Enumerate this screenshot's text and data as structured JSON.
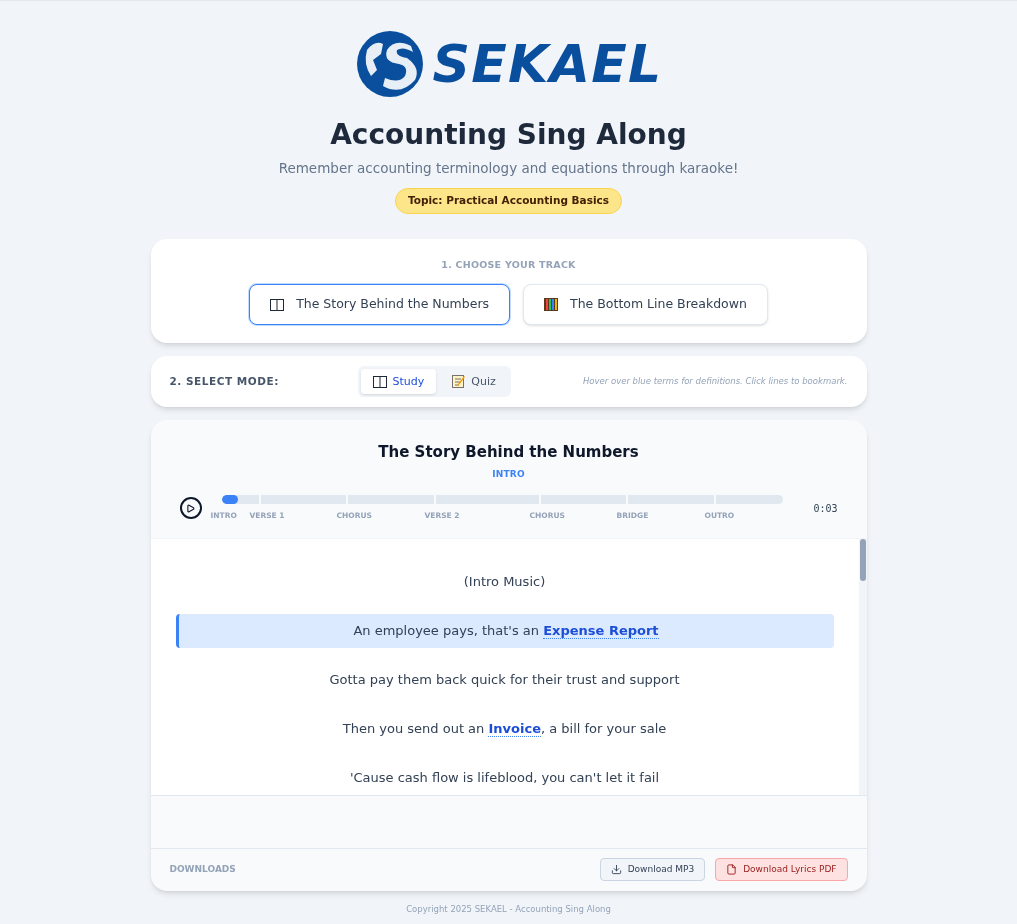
{
  "logo": {
    "text": "SEKAEL"
  },
  "title": "Accounting Sing Along",
  "subtitle": "Remember accounting terminology and equations through karaoke!",
  "topic": "Topic: Practical Accounting Basics",
  "track_section": {
    "heading": "1. CHOOSE YOUR TRACK",
    "tracks": [
      {
        "label": "The Story Behind the Numbers",
        "kind": "book",
        "selected": true
      },
      {
        "label": "The Bottom Line Breakdown",
        "kind": "abacus",
        "selected": false
      }
    ]
  },
  "mode_section": {
    "heading": "2. SELECT MODE:",
    "modes": [
      {
        "label": "Study",
        "kind": "book",
        "selected": true
      },
      {
        "label": "Quiz",
        "kind": "memo",
        "selected": false
      }
    ],
    "hint": "Hover over blue terms for definitions. Click lines to bookmark."
  },
  "player": {
    "song_title": "The Story Behind the Numbers",
    "current_section": "INTRO",
    "time": "0:03",
    "sections": [
      {
        "label": "INTRO",
        "level": 0.45
      },
      {
        "label": "VERSE 1",
        "level": 0
      },
      {
        "label": "CHORUS",
        "level": 0
      },
      {
        "label": "VERSE 2",
        "level": 0
      },
      {
        "label": "CHORUS",
        "level": 0
      },
      {
        "label": "BRIDGE",
        "level": 0
      },
      {
        "label": "OUTRO",
        "level": 0
      }
    ]
  },
  "lyrics": [
    {
      "active": false,
      "parts": [
        {
          "text": "(Intro Music)",
          "term": false
        }
      ]
    },
    {
      "active": true,
      "parts": [
        {
          "text": "An employee pays, that's an ",
          "term": false
        },
        {
          "text": "Expense Report",
          "term": true
        }
      ]
    },
    {
      "active": false,
      "parts": [
        {
          "text": "Gotta pay them back quick for their trust and support",
          "term": false
        }
      ]
    },
    {
      "active": false,
      "parts": [
        {
          "text": "Then you send out an ",
          "term": false
        },
        {
          "text": "Invoice",
          "term": true
        },
        {
          "text": ", a bill for your sale",
          "term": false
        }
      ]
    },
    {
      "active": false,
      "parts": [
        {
          "text": "'Cause cash flow is lifeblood, you can't let it fail",
          "term": false
        }
      ]
    }
  ],
  "downloads": {
    "heading": "DOWNLOADS",
    "buttons": [
      {
        "label": "Download MP3",
        "kind": "mp3"
      },
      {
        "label": "Download Lyrics PDF",
        "kind": "pdf"
      }
    ]
  },
  "footer": "Copyright 2025 SEKAEL - Accounting Sing Along"
}
